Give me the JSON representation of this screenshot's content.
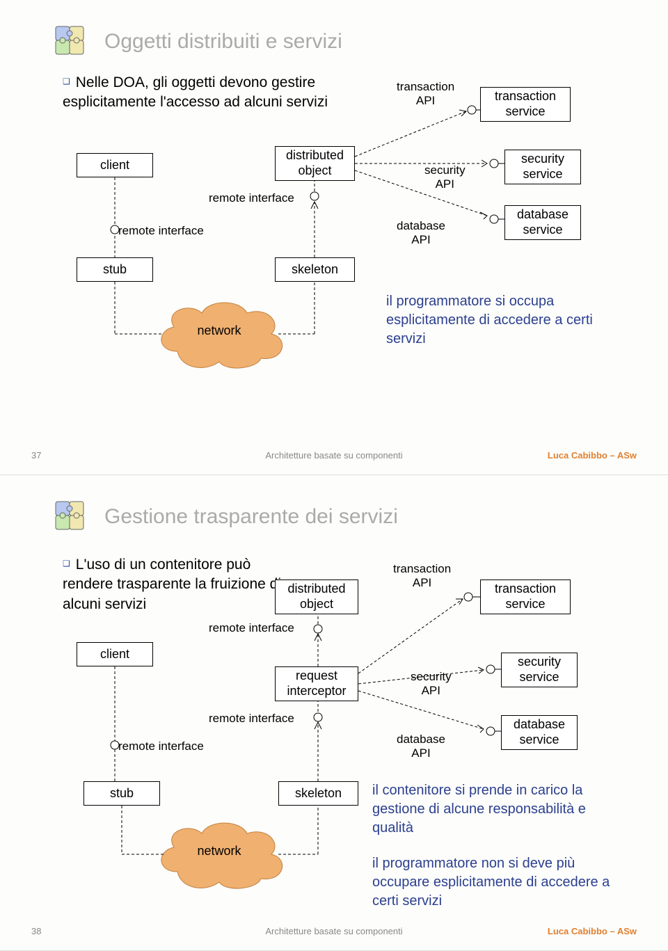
{
  "slide1": {
    "title": "Oggetti distribuiti e servizi",
    "bullet": "Nelle DOA, gli oggetti devono gestire esplicitamente l'accesso ad alcuni servizi",
    "client": "client",
    "stub": "stub",
    "dist_obj": "distributed\nobject",
    "skeleton": "skeleton",
    "remote_iface1": "remote interface",
    "remote_iface2": "remote interface",
    "txn_api": "transaction\nAPI",
    "txn_svc": "transaction\nservice",
    "sec_api": "security\nAPI",
    "sec_svc": "security\nservice",
    "db_api": "database\nAPI",
    "db_svc": "database\nservice",
    "network": "network",
    "note": "il programmatore si occupa esplicitamente di accedere a certi servizi",
    "page": "37",
    "footer": "Architetture basate su componenti",
    "author": "Luca Cabibbo – ASw"
  },
  "slide2": {
    "title": "Gestione trasparente dei servizi",
    "bullet": "L'uso di un contenitore può rendere trasparente la fruizione di alcuni servizi",
    "client": "client",
    "stub": "stub",
    "dist_obj": "distributed\nobject",
    "req_int": "request\ninterceptor",
    "skeleton": "skeleton",
    "remote_iface1": "remote interface",
    "remote_iface2": "remote interface",
    "remote_iface3": "remote interface",
    "txn_api": "transaction\nAPI",
    "txn_svc": "transaction\nservice",
    "sec_api": "security\nAPI",
    "sec_svc": "security\nservice",
    "db_api": "database\nAPI",
    "db_svc": "database\nservice",
    "network": "network",
    "note1": "il contenitore si prende in carico la gestione di alcune responsabilità e qualità",
    "note2": "il programmatore non si deve più occupare esplicitamente di accedere a certi servizi",
    "page": "38",
    "footer": "Architetture basate su componenti",
    "author": "Luca Cabibbo – ASw"
  }
}
